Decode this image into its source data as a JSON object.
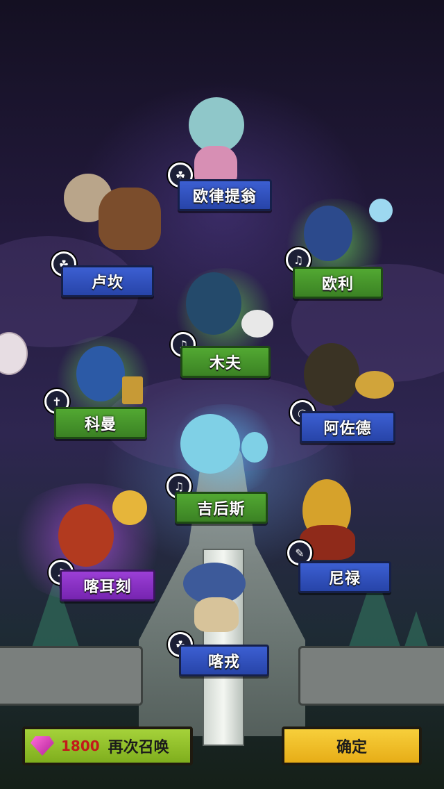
{
  "heroes": [
    {
      "name": "欧律提翁",
      "color": "blue",
      "badge_icon": "☘"
    },
    {
      "name": "卢坎",
      "color": "blue",
      "badge_icon": "☘"
    },
    {
      "name": "欧利",
      "color": "green",
      "badge_icon": "♫"
    },
    {
      "name": "木夫",
      "color": "green",
      "badge_icon": "♫"
    },
    {
      "name": "科曼",
      "color": "green",
      "badge_icon": "✝"
    },
    {
      "name": "阿佐德",
      "color": "blue",
      "badge_icon": "◎"
    },
    {
      "name": "吉后斯",
      "color": "green",
      "badge_icon": "♫"
    },
    {
      "name": "喀耳刻",
      "color": "purple",
      "badge_icon": "♫"
    },
    {
      "name": "尼禄",
      "color": "blue",
      "badge_icon": "✎"
    },
    {
      "name": "喀戎",
      "color": "blue",
      "badge_icon": "☘"
    }
  ],
  "buttons": {
    "summon_cost": "1800",
    "summon_label": "再次召唤",
    "confirm_label": "确定"
  },
  "colors": {
    "blue_banner": "#3c5fd2",
    "green_banner": "#52a832",
    "purple_banner": "#9b3fd6",
    "summon_button": "#a5d23a",
    "confirm_button": "#f7cf3b",
    "cost_text": "#c21a1a"
  }
}
